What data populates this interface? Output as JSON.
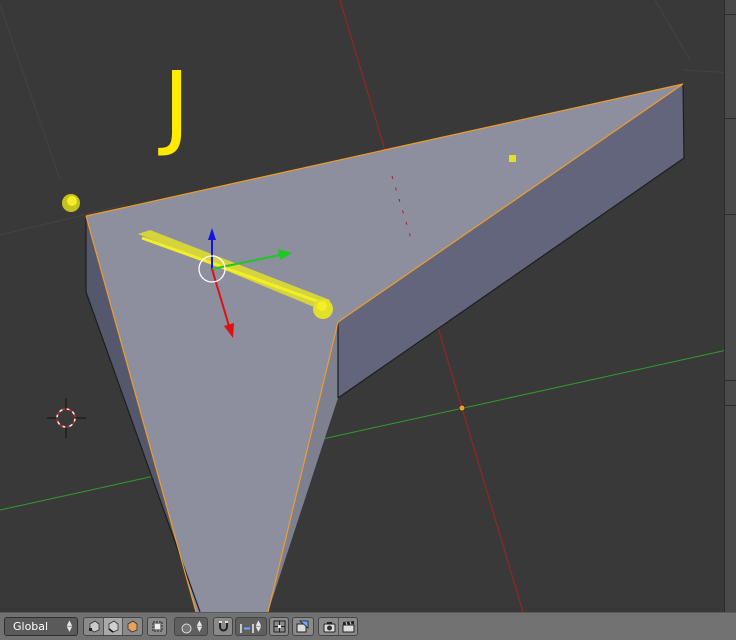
{
  "viewport": {
    "hint_letter": "J",
    "colors": {
      "background": "#393939",
      "face_top": "#8d8f9e",
      "face_side_dark": "#55586d",
      "face_side_right": "#62657c",
      "edge_selected": "#f09c28",
      "axis_x": "#c02323",
      "axis_y": "#2e9d2e",
      "axis_z": "#1414e0",
      "grease_pencil": "#f2ef28",
      "highlight_text": "#ffea00"
    },
    "icons": [
      "3d-cursor-icon",
      "transform-manipulator-icon"
    ]
  },
  "header": {
    "orientation_label": "Global",
    "icons": [
      "select-mode-vertex-icon",
      "select-mode-edge-icon",
      "select-mode-face-icon",
      "limit-to-visible-icon",
      "proportional-editing-icon",
      "snap-magnet-icon",
      "snap-element-icon",
      "snap-target-icon",
      "render-icon",
      "render-animation-icon"
    ]
  }
}
